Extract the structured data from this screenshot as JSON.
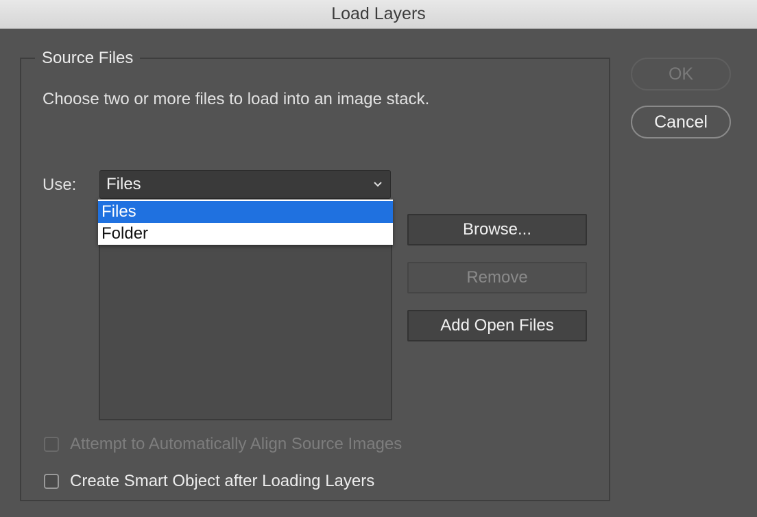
{
  "window": {
    "title": "Load Layers"
  },
  "source_files": {
    "legend": "Source Files",
    "description": "Choose two or more files to load into an image stack.",
    "use_label": "Use:",
    "use_selected": "Files",
    "use_options": [
      "Files",
      "Folder"
    ],
    "browse_label": "Browse...",
    "remove_label": "Remove",
    "add_open_files_label": "Add Open Files"
  },
  "options": {
    "auto_align_label": "Attempt to Automatically Align Source Images",
    "auto_align_checked": false,
    "auto_align_enabled": false,
    "smart_object_label": "Create Smart Object after Loading Layers",
    "smart_object_checked": false
  },
  "actions": {
    "ok_label": "OK",
    "cancel_label": "Cancel"
  },
  "colors": {
    "background": "#535353",
    "selection": "#1f71e0"
  },
  "icons": {
    "dropdown": "chevron-down-icon"
  }
}
